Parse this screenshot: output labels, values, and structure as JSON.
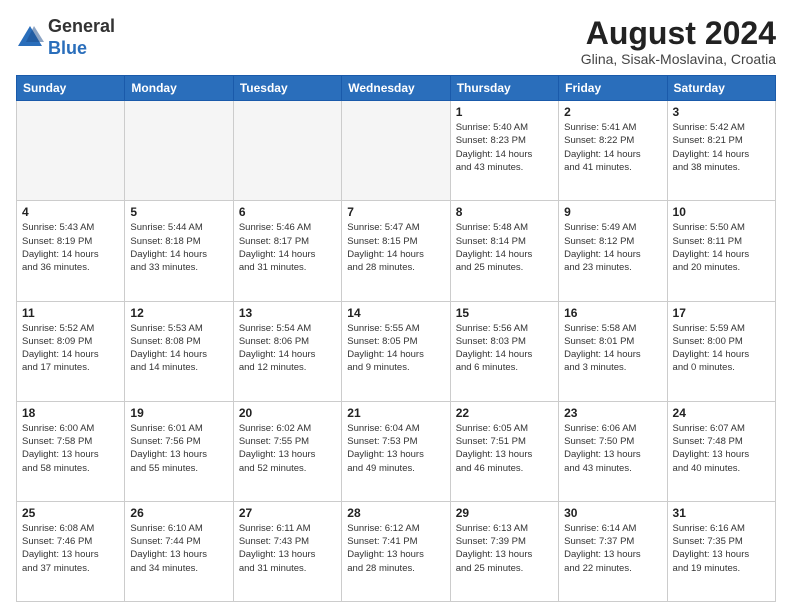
{
  "logo": {
    "general": "General",
    "blue": "Blue"
  },
  "header": {
    "month_year": "August 2024",
    "location": "Glina, Sisak-Moslavina, Croatia"
  },
  "days_of_week": [
    "Sunday",
    "Monday",
    "Tuesday",
    "Wednesday",
    "Thursday",
    "Friday",
    "Saturday"
  ],
  "weeks": [
    [
      {
        "day": "",
        "info": ""
      },
      {
        "day": "",
        "info": ""
      },
      {
        "day": "",
        "info": ""
      },
      {
        "day": "",
        "info": ""
      },
      {
        "day": "1",
        "info": "Sunrise: 5:40 AM\nSunset: 8:23 PM\nDaylight: 14 hours\nand 43 minutes."
      },
      {
        "day": "2",
        "info": "Sunrise: 5:41 AM\nSunset: 8:22 PM\nDaylight: 14 hours\nand 41 minutes."
      },
      {
        "day": "3",
        "info": "Sunrise: 5:42 AM\nSunset: 8:21 PM\nDaylight: 14 hours\nand 38 minutes."
      }
    ],
    [
      {
        "day": "4",
        "info": "Sunrise: 5:43 AM\nSunset: 8:19 PM\nDaylight: 14 hours\nand 36 minutes."
      },
      {
        "day": "5",
        "info": "Sunrise: 5:44 AM\nSunset: 8:18 PM\nDaylight: 14 hours\nand 33 minutes."
      },
      {
        "day": "6",
        "info": "Sunrise: 5:46 AM\nSunset: 8:17 PM\nDaylight: 14 hours\nand 31 minutes."
      },
      {
        "day": "7",
        "info": "Sunrise: 5:47 AM\nSunset: 8:15 PM\nDaylight: 14 hours\nand 28 minutes."
      },
      {
        "day": "8",
        "info": "Sunrise: 5:48 AM\nSunset: 8:14 PM\nDaylight: 14 hours\nand 25 minutes."
      },
      {
        "day": "9",
        "info": "Sunrise: 5:49 AM\nSunset: 8:12 PM\nDaylight: 14 hours\nand 23 minutes."
      },
      {
        "day": "10",
        "info": "Sunrise: 5:50 AM\nSunset: 8:11 PM\nDaylight: 14 hours\nand 20 minutes."
      }
    ],
    [
      {
        "day": "11",
        "info": "Sunrise: 5:52 AM\nSunset: 8:09 PM\nDaylight: 14 hours\nand 17 minutes."
      },
      {
        "day": "12",
        "info": "Sunrise: 5:53 AM\nSunset: 8:08 PM\nDaylight: 14 hours\nand 14 minutes."
      },
      {
        "day": "13",
        "info": "Sunrise: 5:54 AM\nSunset: 8:06 PM\nDaylight: 14 hours\nand 12 minutes."
      },
      {
        "day": "14",
        "info": "Sunrise: 5:55 AM\nSunset: 8:05 PM\nDaylight: 14 hours\nand 9 minutes."
      },
      {
        "day": "15",
        "info": "Sunrise: 5:56 AM\nSunset: 8:03 PM\nDaylight: 14 hours\nand 6 minutes."
      },
      {
        "day": "16",
        "info": "Sunrise: 5:58 AM\nSunset: 8:01 PM\nDaylight: 14 hours\nand 3 minutes."
      },
      {
        "day": "17",
        "info": "Sunrise: 5:59 AM\nSunset: 8:00 PM\nDaylight: 14 hours\nand 0 minutes."
      }
    ],
    [
      {
        "day": "18",
        "info": "Sunrise: 6:00 AM\nSunset: 7:58 PM\nDaylight: 13 hours\nand 58 minutes."
      },
      {
        "day": "19",
        "info": "Sunrise: 6:01 AM\nSunset: 7:56 PM\nDaylight: 13 hours\nand 55 minutes."
      },
      {
        "day": "20",
        "info": "Sunrise: 6:02 AM\nSunset: 7:55 PM\nDaylight: 13 hours\nand 52 minutes."
      },
      {
        "day": "21",
        "info": "Sunrise: 6:04 AM\nSunset: 7:53 PM\nDaylight: 13 hours\nand 49 minutes."
      },
      {
        "day": "22",
        "info": "Sunrise: 6:05 AM\nSunset: 7:51 PM\nDaylight: 13 hours\nand 46 minutes."
      },
      {
        "day": "23",
        "info": "Sunrise: 6:06 AM\nSunset: 7:50 PM\nDaylight: 13 hours\nand 43 minutes."
      },
      {
        "day": "24",
        "info": "Sunrise: 6:07 AM\nSunset: 7:48 PM\nDaylight: 13 hours\nand 40 minutes."
      }
    ],
    [
      {
        "day": "25",
        "info": "Sunrise: 6:08 AM\nSunset: 7:46 PM\nDaylight: 13 hours\nand 37 minutes."
      },
      {
        "day": "26",
        "info": "Sunrise: 6:10 AM\nSunset: 7:44 PM\nDaylight: 13 hours\nand 34 minutes."
      },
      {
        "day": "27",
        "info": "Sunrise: 6:11 AM\nSunset: 7:43 PM\nDaylight: 13 hours\nand 31 minutes."
      },
      {
        "day": "28",
        "info": "Sunrise: 6:12 AM\nSunset: 7:41 PM\nDaylight: 13 hours\nand 28 minutes."
      },
      {
        "day": "29",
        "info": "Sunrise: 6:13 AM\nSunset: 7:39 PM\nDaylight: 13 hours\nand 25 minutes."
      },
      {
        "day": "30",
        "info": "Sunrise: 6:14 AM\nSunset: 7:37 PM\nDaylight: 13 hours\nand 22 minutes."
      },
      {
        "day": "31",
        "info": "Sunrise: 6:16 AM\nSunset: 7:35 PM\nDaylight: 13 hours\nand 19 minutes."
      }
    ]
  ]
}
